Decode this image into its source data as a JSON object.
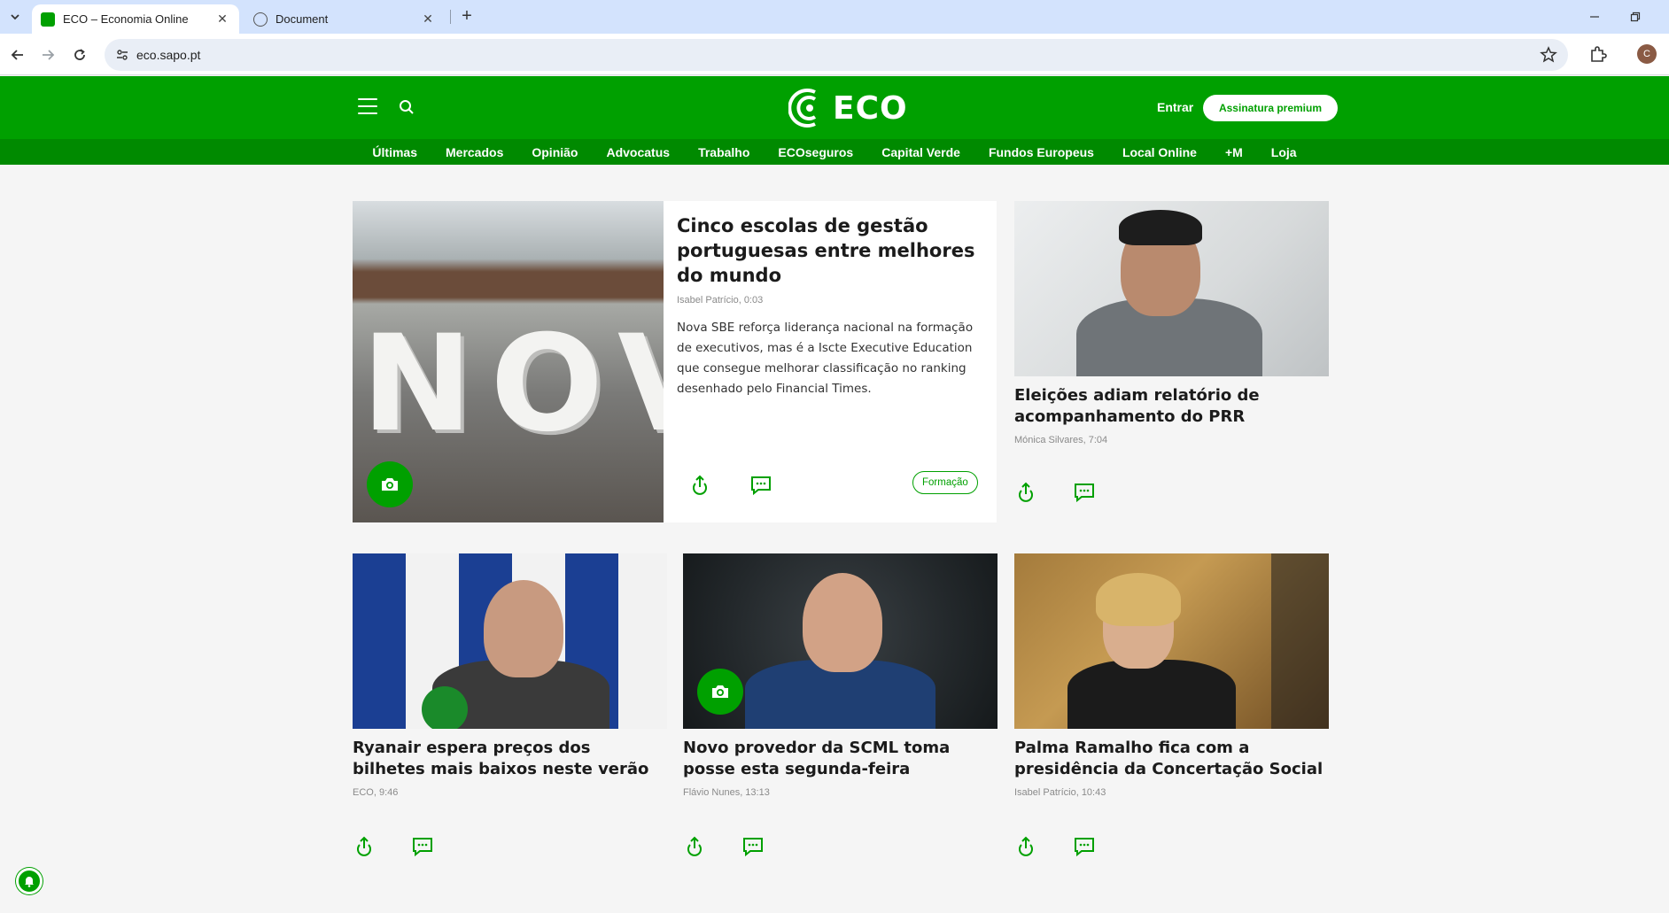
{
  "browser": {
    "tabs": [
      {
        "title": "ECO – Economia Online",
        "active": true
      },
      {
        "title": "Document",
        "active": false
      }
    ],
    "url": "eco.sapo.pt",
    "profile_initial": "C"
  },
  "site": {
    "logo_text": "ECO",
    "login_label": "Entrar",
    "premium_label": "Assinatura premium",
    "brand_color": "#00a000",
    "nav": [
      "Últimas",
      "Mercados",
      "Opinião",
      "Advocatus",
      "Trabalho",
      "ECOseguros",
      "Capital Verde",
      "Fundos Europeus",
      "Local Online",
      "+M",
      "Loja"
    ]
  },
  "feature": {
    "title": "Cinco escolas de gestão portuguesas entre melhores do mundo",
    "byline": "Isabel Patrício, 0:03",
    "summary": "Nova SBE reforça liderança nacional na formação de executivos, mas é a Iscte Executive Education que consegue melhorar classificação no ranking desenhado pelo Financial Times.",
    "tag": "Formação",
    "image_letters": "NOV"
  },
  "cards": [
    {
      "title": "Eleições adiam relatório de acompanhamento do PRR",
      "byline": "Mónica Silvares, 7:04"
    },
    {
      "title": "Ryanair espera preços dos bilhetes mais baixos neste verão",
      "byline": "ECO, 9:46"
    },
    {
      "title": "Novo provedor da SCML toma posse esta segunda-feira",
      "byline": "Flávio Nunes, 13:13"
    },
    {
      "title": "Palma Ramalho fica com a presidência da Concertação Social",
      "byline": "Isabel Patrício, 10:43"
    }
  ]
}
